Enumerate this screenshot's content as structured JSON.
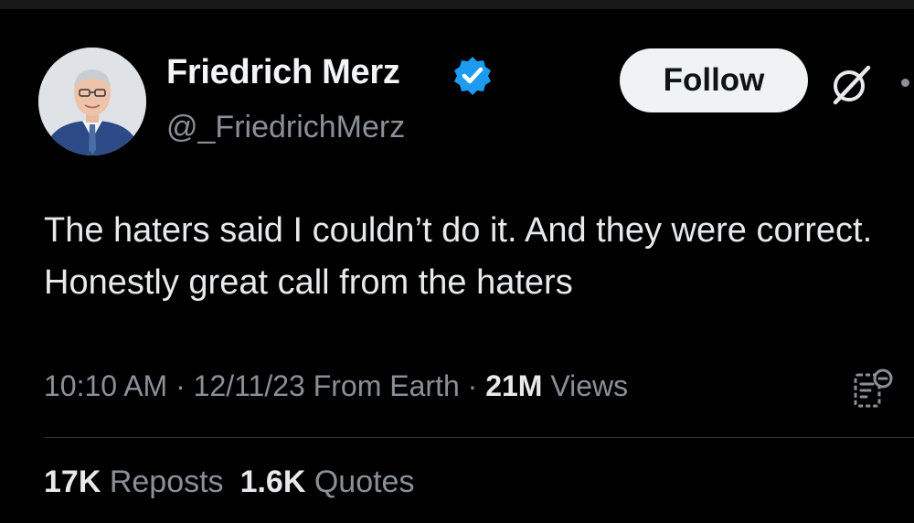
{
  "author": {
    "display_name": "Friedrich Merz",
    "handle": "@_FriedrichMerz",
    "verified": true
  },
  "follow_button": {
    "label": "Follow"
  },
  "tweet": {
    "text": "The haters said I couldn’t do it. And they were correct. Honestly great call from the haters"
  },
  "meta": {
    "time": "10:10 AM",
    "separator": " · ",
    "date": "12/11/23",
    "source": " From Earth",
    "separator2": " · ",
    "views_count": "21M",
    "views_label": " Views"
  },
  "stats": {
    "reposts_count": "17K",
    "reposts_label": " Reposts",
    "quotes_count": "1.6K",
    "quotes_label": " Quotes"
  },
  "icons": {
    "verified": "verified-badge-icon",
    "grok": "grok-icon",
    "analytics": "post-analytics-icon"
  },
  "colors": {
    "background": "#000000",
    "text_primary": "#e7e9ea",
    "text_secondary": "#8a9098",
    "verified_blue": "#1d9bf0",
    "follow_bg": "#eff3f4",
    "divider": "#2f3336"
  }
}
